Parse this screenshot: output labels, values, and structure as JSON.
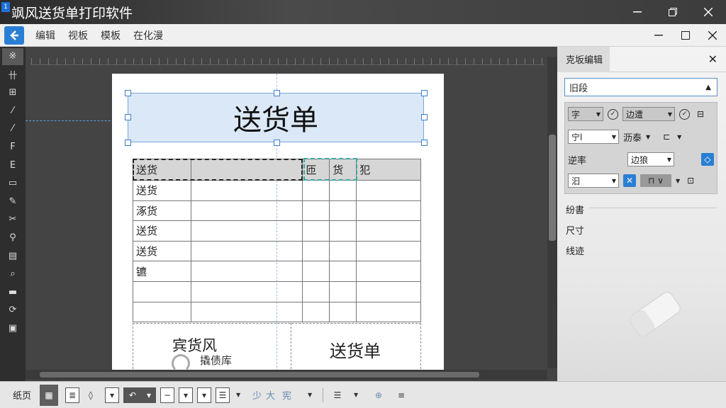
{
  "window": {
    "icon_text": "1",
    "title": "飒风送货单打印软件",
    "min_icon": "minimize-icon",
    "max_icon": "restore-icon",
    "close_icon": "close-icon"
  },
  "menu": {
    "items": [
      "编辑",
      "视板",
      "模板",
      "在化漫"
    ]
  },
  "left_tools": [
    "※",
    "卄",
    "⊞",
    "⁄",
    "⁄",
    "F",
    "E",
    "▭",
    "✎",
    "✂",
    "⚲",
    "▤",
    "⌕",
    "▬",
    "⟳",
    "▣"
  ],
  "document": {
    "title": "送货单",
    "table_header": [
      "送货",
      "",
      "匝",
      "货",
      "犯"
    ],
    "table_rows": [
      [
        "送货",
        "",
        "",
        "",
        ""
      ],
      [
        "涿货",
        "",
        "",
        "",
        ""
      ],
      [
        "送货",
        "",
        "",
        "",
        ""
      ],
      [
        "送货",
        "",
        "",
        "",
        ""
      ],
      [
        "镳",
        "",
        "",
        "",
        ""
      ],
      [
        "",
        "",
        "",
        "",
        ""
      ],
      [
        "",
        "",
        "",
        "",
        ""
      ]
    ],
    "footer_left": "宾货风",
    "footer_sub": "撬债库",
    "footer_right": "送货单"
  },
  "right_panel": {
    "tab": "克坂编辑",
    "select_value": "旧段",
    "row1": {
      "dd1": "字",
      "dd2": "边遭"
    },
    "row2": {
      "dd1": "宁l",
      "label": "沥泰"
    },
    "row3": {
      "label": "逆率",
      "dd": "边狼"
    },
    "row4": {
      "dd": "汩"
    },
    "section_labels": [
      "纷書",
      "尺寸",
      "线迹"
    ]
  },
  "bottom": {
    "label": "纸页",
    "text1": "少",
    "text2": "大",
    "text3": "宪"
  },
  "colors": {
    "accent": "#2a7fd4",
    "title_fill": "#dbe8f7",
    "header_fill": "#d6d6d6"
  }
}
